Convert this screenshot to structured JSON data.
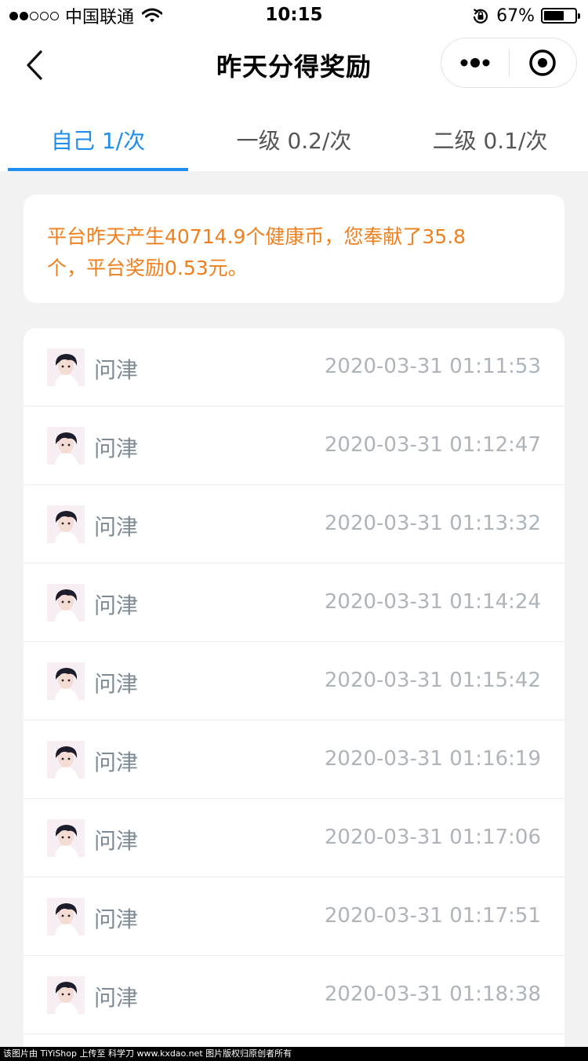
{
  "status_bar": {
    "carrier": "中国联通",
    "time": "10:15",
    "battery": "67%",
    "battery_level": 0.67,
    "signal_strength": 2
  },
  "nav": {
    "title": "昨天分得奖励",
    "back_icon": "chevron-left-icon",
    "more_icon": "more-dots-icon",
    "close_icon": "target-circle-icon"
  },
  "tabs": [
    {
      "label": "自己 1/次",
      "active": true
    },
    {
      "label": "一级 0.2/次",
      "active": false
    },
    {
      "label": "二级 0.1/次",
      "active": false
    }
  ],
  "info": {
    "line1": "平台昨天产生40714.9个健康币，您奉献了35.8",
    "line2": "个，平台奖励0.53元。"
  },
  "records": [
    {
      "name": "问津",
      "time": "2020-03-31 01:11:53"
    },
    {
      "name": "问津",
      "time": "2020-03-31 01:12:47"
    },
    {
      "name": "问津",
      "time": "2020-03-31 01:13:32"
    },
    {
      "name": "问津",
      "time": "2020-03-31 01:14:24"
    },
    {
      "name": "问津",
      "time": "2020-03-31 01:15:42"
    },
    {
      "name": "问津",
      "time": "2020-03-31 01:16:19"
    },
    {
      "name": "问津",
      "time": "2020-03-31 01:17:06"
    },
    {
      "name": "问津",
      "time": "2020-03-31 01:17:51"
    },
    {
      "name": "问津",
      "time": "2020-03-31 01:18:38"
    }
  ],
  "footer": {
    "text": "该图片由 TiYiShop 上传至 科学刀 www.kxdao.net 图片版权归原创者所有"
  },
  "colors": {
    "accent": "#1f8cf0",
    "info_text": "#f07f1e",
    "background": "#f2f2f2"
  }
}
